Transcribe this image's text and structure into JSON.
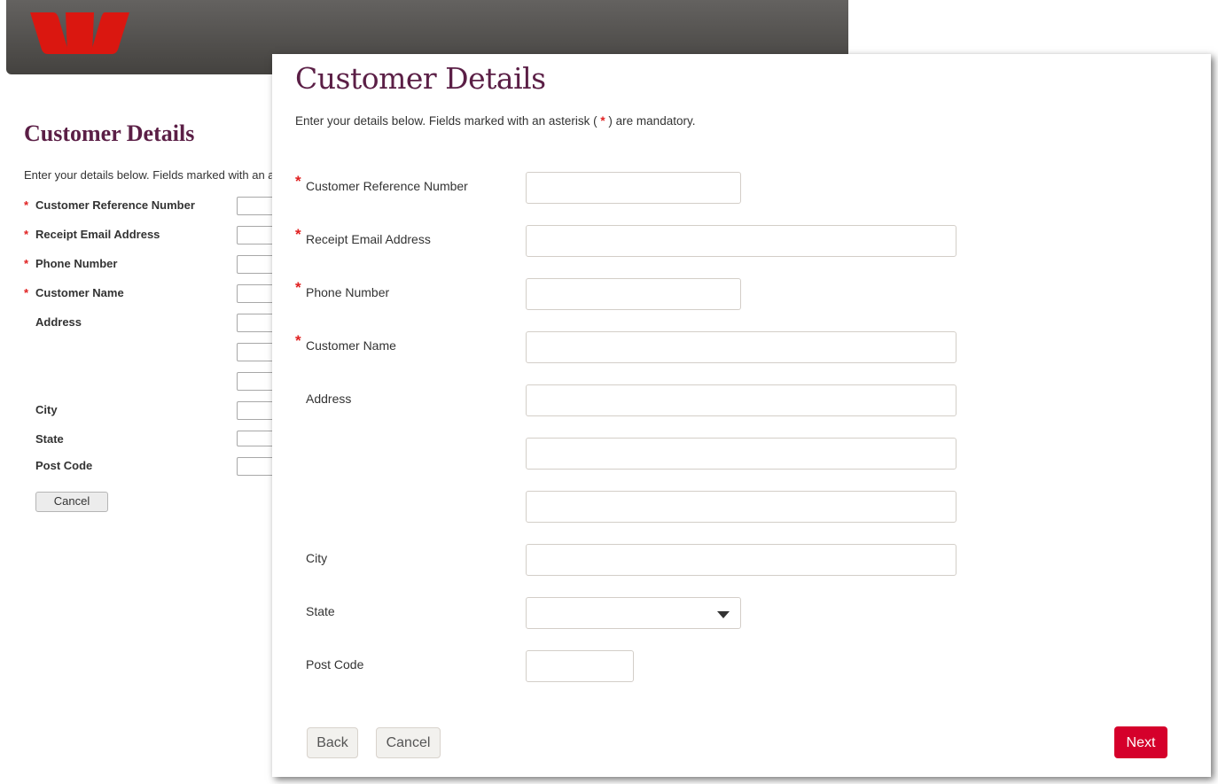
{
  "background_page": {
    "brand_color": "#da1710",
    "title": "Customer Details",
    "intro": "Enter your details below. Fields marked with an a",
    "fields": [
      {
        "label": "Customer Reference Number",
        "required": true
      },
      {
        "label": "Receipt Email Address",
        "required": true
      },
      {
        "label": "Phone Number",
        "required": true
      },
      {
        "label": "Customer Name",
        "required": true
      },
      {
        "label": "Address",
        "required": false
      },
      {
        "label": "City",
        "required": false
      },
      {
        "label": "State",
        "required": false
      },
      {
        "label": "Post Code",
        "required": false
      }
    ],
    "cancel_label": "Cancel",
    "asterisk": "*"
  },
  "dialog": {
    "title": "Customer Details",
    "intro_before": "Enter your details below. Fields marked with an asterisk ( ",
    "intro_asterisk": "*",
    "intro_after": " ) are mandatory.",
    "asterisk": "*",
    "fields": {
      "customer_reference_number": {
        "label": "Customer Reference Number",
        "value": "",
        "required": true
      },
      "receipt_email_address": {
        "label": "Receipt Email Address",
        "value": "",
        "required": true
      },
      "phone_number": {
        "label": "Phone Number",
        "value": "",
        "required": true
      },
      "customer_name": {
        "label": "Customer Name",
        "value": "",
        "required": true
      },
      "address": {
        "label": "Address",
        "line1": "",
        "line2": "",
        "line3": "",
        "required": false
      },
      "city": {
        "label": "City",
        "value": "",
        "required": false
      },
      "state": {
        "label": "State",
        "selected": "",
        "required": false
      },
      "post_code": {
        "label": "Post Code",
        "value": "",
        "required": false
      }
    },
    "buttons": {
      "back": "Back",
      "cancel": "Cancel",
      "next": "Next"
    },
    "accent_color": "#d5002b",
    "title_color": "#5b1f46"
  }
}
